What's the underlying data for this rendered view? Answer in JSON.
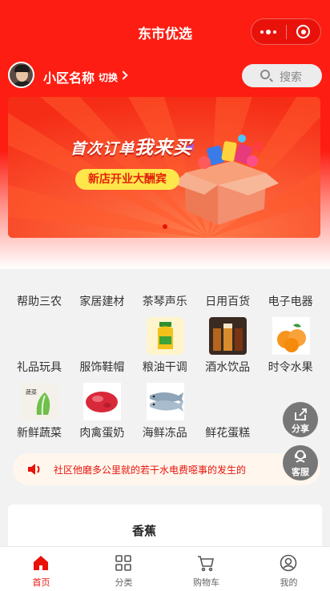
{
  "app": {
    "title": "东市优选"
  },
  "header": {
    "community_name": "小区名称",
    "switch_label": "切换",
    "search_placeholder": "搜索"
  },
  "banner": {
    "headline_part1": "首次订单",
    "headline_part2": "我来买",
    "pill_text": "新店开业大酬宾",
    "slide_count": 1,
    "active_slide": 1
  },
  "categories": [
    {
      "label": "帮助三农",
      "icon": ""
    },
    {
      "label": "家居建材",
      "icon": ""
    },
    {
      "label": "茶琴声乐",
      "icon": ""
    },
    {
      "label": "日用百货",
      "icon": ""
    },
    {
      "label": "电子电器",
      "icon": ""
    },
    {
      "label": "礼品玩具",
      "icon": ""
    },
    {
      "label": "服饰鞋帽",
      "icon": ""
    },
    {
      "label": "粮油干调",
      "icon": "oil-bottle-icon"
    },
    {
      "label": "酒水饮品",
      "icon": "drinks-icon"
    },
    {
      "label": "时令水果",
      "icon": "orange-icon"
    },
    {
      "label": "新鲜蔬菜",
      "icon": "vegetable-icon"
    },
    {
      "label": "肉禽蛋奶",
      "icon": "meat-icon"
    },
    {
      "label": "海鲜冻品",
      "icon": "fish-icon"
    },
    {
      "label": "鲜花蛋糕",
      "icon": ""
    }
  ],
  "notice": {
    "text": "社区他磨多公里就的若干水电费噁事的发生的"
  },
  "floating": {
    "share_label": "分享",
    "service_label": "客服"
  },
  "product_card": {
    "name": "香蕉"
  },
  "tabbar": [
    {
      "label": "首页",
      "icon": "home-icon",
      "active": true
    },
    {
      "label": "分类",
      "icon": "grid-icon",
      "active": false
    },
    {
      "label": "购物车",
      "icon": "cart-icon",
      "active": false
    },
    {
      "label": "我的",
      "icon": "user-icon",
      "active": false
    }
  ],
  "colors": {
    "brand_red": "#fd1d12",
    "accent_yellow": "#ffe64a",
    "notice_bg": "#fff7ee"
  }
}
